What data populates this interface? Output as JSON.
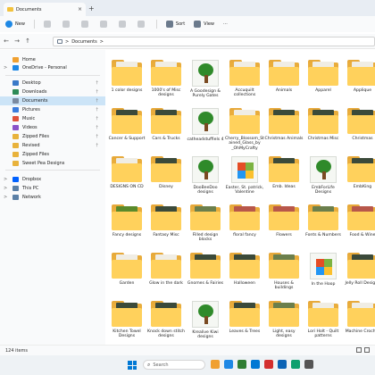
{
  "window": {
    "tab_title": "Documents",
    "new_tab_label": "+",
    "toolbar": {
      "new_label": "New",
      "sort_label": "Sort",
      "view_label": "View",
      "more_label": "···"
    },
    "address": {
      "segments": [
        ">",
        "Documents",
        ">"
      ],
      "back": "←",
      "forward": "→",
      "up": "↑"
    },
    "sidebar": {
      "items": [
        {
          "label": "Home",
          "color": "#f0a030",
          "chev": ""
        },
        {
          "label": "OneDrive - Personal",
          "color": "#1e88e5",
          "chev": ">"
        },
        {
          "label": "Desktop",
          "color": "#3a79c8",
          "pinned": true
        },
        {
          "label": "Downloads",
          "color": "#2e8b57",
          "pinned": true
        },
        {
          "label": "Documents",
          "color": "#7b8aa0",
          "pinned": true,
          "selected": true
        },
        {
          "label": "Pictures",
          "color": "#3b7ddd",
          "pinned": true
        },
        {
          "label": "Music",
          "color": "#e0533b",
          "pinned": true
        },
        {
          "label": "Videos",
          "color": "#8a52c8",
          "pinned": true
        },
        {
          "label": "Zipped Files",
          "color": "#e8b23c",
          "pinned": true
        },
        {
          "label": "Revised",
          "color": "#e8b23c",
          "pinned": true
        },
        {
          "label": "Zipped Files",
          "color": "#e8b23c"
        },
        {
          "label": "Sweet Pea Designs",
          "color": "#e8b23c"
        },
        {
          "label": "Dropbox",
          "color": "#0061ff",
          "chev": ">"
        },
        {
          "label": "This PC",
          "color": "#5a7fa6",
          "chev": ">"
        },
        {
          "label": "Network",
          "color": "#5a7fa6",
          "chev": ">"
        }
      ]
    },
    "items": [
      {
        "label": "1 color designs",
        "kind": "folder",
        "paper": "p-white"
      },
      {
        "label": "1000's of Misc designs",
        "kind": "folder",
        "paper": "p-white"
      },
      {
        "label": "A Goodesign & Purely Gates",
        "kind": "tree"
      },
      {
        "label": "Accuquilt collections",
        "kind": "folder",
        "paper": "p-white"
      },
      {
        "label": "Animals",
        "kind": "folder",
        "paper": "p-white"
      },
      {
        "label": "Apparel",
        "kind": "folder",
        "paper": "p-white"
      },
      {
        "label": "Applique",
        "kind": "folder",
        "paper": "p-white"
      },
      {
        "label": "Cancer & Support",
        "kind": "folder",
        "paper": "p-dark"
      },
      {
        "label": "Cars & Trucks",
        "kind": "folder",
        "paper": "p-dark"
      },
      {
        "label": "catheadstuffiels 4",
        "kind": "tree"
      },
      {
        "label": "Cherry_Blossom_Stained_Glass_by _OhMyCrafty",
        "kind": "folder",
        "paper": "p-white"
      },
      {
        "label": "Christmas Animals",
        "kind": "folder",
        "paper": "p-dark"
      },
      {
        "label": "Christmas Misc",
        "kind": "folder",
        "paper": "p-dark"
      },
      {
        "label": "Christmas",
        "kind": "folder",
        "paper": "p-dark"
      },
      {
        "label": "DESIGNS ON CD",
        "kind": "folder",
        "paper": "p-white"
      },
      {
        "label": "Disney",
        "kind": "folder",
        "paper": "p-dark"
      },
      {
        "label": "DooBeeDoo designs",
        "kind": "tree"
      },
      {
        "label": "Easter, St. patrick, Valentine",
        "kind": "logo"
      },
      {
        "label": "Emb. Ideas",
        "kind": "folder",
        "paper": "p-dark"
      },
      {
        "label": "EmbForLife Designs",
        "kind": "tree"
      },
      {
        "label": "EmbKing",
        "kind": "folder",
        "paper": "p-dark"
      },
      {
        "label": "Fancy designs",
        "kind": "folder",
        "paper": "p-green"
      },
      {
        "label": "Fantasy Misc",
        "kind": "folder",
        "paper": "p-dark"
      },
      {
        "label": "Filled design blocks",
        "kind": "folder",
        "paper": "p-multi"
      },
      {
        "label": "floral fancy",
        "kind": "folder",
        "paper": "p-red"
      },
      {
        "label": "Flowers",
        "kind": "folder",
        "paper": "p-red"
      },
      {
        "label": "Fonts & Numbers",
        "kind": "folder",
        "paper": "p-multi"
      },
      {
        "label": "Food & Wine",
        "kind": "folder",
        "paper": "p-red"
      },
      {
        "label": "Garden",
        "kind": "folder",
        "paper": "p-white"
      },
      {
        "label": "Glow in the dark",
        "kind": "folder",
        "paper": "p-white"
      },
      {
        "label": "Gnomes & Fairies",
        "kind": "folder",
        "paper": "p-dark"
      },
      {
        "label": "Halloween",
        "kind": "folder",
        "paper": "p-dark"
      },
      {
        "label": "Houses & buildings",
        "kind": "folder",
        "paper": "p-multi"
      },
      {
        "label": "In the Hoop",
        "kind": "logo"
      },
      {
        "label": "Jelly Roll Designs",
        "kind": "folder",
        "paper": "p-dark"
      },
      {
        "label": "Kitchen Towel Designs",
        "kind": "folder",
        "paper": "p-dark"
      },
      {
        "label": "Knock down stitch designs",
        "kind": "folder",
        "paper": "p-dark"
      },
      {
        "label": "Krealive Kiwi designs",
        "kind": "tree"
      },
      {
        "label": "Leaves & Trees",
        "kind": "folder",
        "paper": "p-dark"
      },
      {
        "label": "Light, easy designs",
        "kind": "folder",
        "paper": "p-multi"
      },
      {
        "label": "Lori Holt - Quilt patterns",
        "kind": "folder",
        "paper": "p-white"
      },
      {
        "label": "Machine Crochet",
        "kind": "folder",
        "paper": "p-white"
      }
    ],
    "status": {
      "count": "124 items"
    }
  },
  "taskbar": {
    "search_placeholder": "Search",
    "apps": [
      "#f0a030",
      "#1e88e5",
      "#2e7d32",
      "#0078d4",
      "#d32f2f",
      "#0b63b5",
      "#0e9f6e",
      "#555555"
    ]
  }
}
